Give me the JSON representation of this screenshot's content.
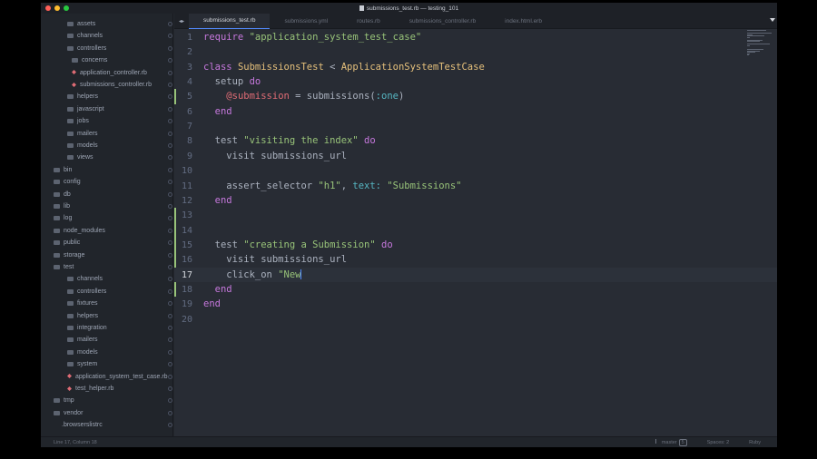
{
  "window": {
    "title": "submissions_test.rb — testing_101"
  },
  "sidebar": {
    "items": [
      {
        "label": "assets",
        "type": "folder",
        "indent": 1
      },
      {
        "label": "channels",
        "type": "folder",
        "indent": 1
      },
      {
        "label": "controllers",
        "type": "folder",
        "indent": 1
      },
      {
        "label": "concerns",
        "type": "folder",
        "indent": 2
      },
      {
        "label": "application_controller.rb",
        "type": "ruby",
        "indent": 2
      },
      {
        "label": "submissions_controller.rb",
        "type": "ruby",
        "indent": 2
      },
      {
        "label": "helpers",
        "type": "folder",
        "indent": 1
      },
      {
        "label": "javascript",
        "type": "folder",
        "indent": 1
      },
      {
        "label": "jobs",
        "type": "folder",
        "indent": 1
      },
      {
        "label": "mailers",
        "type": "folder",
        "indent": 1
      },
      {
        "label": "models",
        "type": "folder",
        "indent": 1
      },
      {
        "label": "views",
        "type": "folder",
        "indent": 1
      },
      {
        "label": "bin",
        "type": "folder",
        "indent": 0
      },
      {
        "label": "config",
        "type": "folder",
        "indent": 0
      },
      {
        "label": "db",
        "type": "folder",
        "indent": 0
      },
      {
        "label": "lib",
        "type": "folder",
        "indent": 0
      },
      {
        "label": "log",
        "type": "folder",
        "indent": 0
      },
      {
        "label": "node_modules",
        "type": "folder",
        "indent": 0
      },
      {
        "label": "public",
        "type": "folder",
        "indent": 0
      },
      {
        "label": "storage",
        "type": "folder",
        "indent": 0
      },
      {
        "label": "test",
        "type": "folder",
        "indent": 0
      },
      {
        "label": "channels",
        "type": "folder",
        "indent": 1
      },
      {
        "label": "controllers",
        "type": "folder",
        "indent": 1
      },
      {
        "label": "fixtures",
        "type": "folder",
        "indent": 1
      },
      {
        "label": "helpers",
        "type": "folder",
        "indent": 1
      },
      {
        "label": "integration",
        "type": "folder",
        "indent": 1
      },
      {
        "label": "mailers",
        "type": "folder",
        "indent": 1
      },
      {
        "label": "models",
        "type": "folder",
        "indent": 1
      },
      {
        "label": "system",
        "type": "folder",
        "indent": 1
      },
      {
        "label": "application_system_test_case.rb",
        "type": "ruby",
        "indent": 1
      },
      {
        "label": "test_helper.rb",
        "type": "ruby",
        "indent": 1
      },
      {
        "label": "tmp",
        "type": "folder",
        "indent": 0
      },
      {
        "label": "vendor",
        "type": "folder",
        "indent": 0
      },
      {
        "label": ".browserslistrc",
        "type": "file",
        "indent": 0
      }
    ]
  },
  "tabs": [
    {
      "label": "submissions_test.rb",
      "active": true
    },
    {
      "label": "submissions.yml",
      "active": false
    },
    {
      "label": "routes.rb",
      "active": false
    },
    {
      "label": "submissions_controller.rb",
      "active": false
    },
    {
      "label": "index.html.erb",
      "active": false
    }
  ],
  "editor": {
    "current_line": 17,
    "lines": [
      {
        "n": "1",
        "tokens": [
          [
            "kw",
            "require"
          ],
          [
            "plain",
            " "
          ],
          [
            "str",
            "\"application_system_test_case\""
          ]
        ]
      },
      {
        "n": "2",
        "tokens": []
      },
      {
        "n": "3",
        "tokens": [
          [
            "kw",
            "class"
          ],
          [
            "plain",
            " "
          ],
          [
            "cls",
            "SubmissionsTest"
          ],
          [
            "plain",
            " < "
          ],
          [
            "cls",
            "ApplicationSystemTestCase"
          ]
        ]
      },
      {
        "n": "4",
        "tokens": [
          [
            "plain",
            "  setup "
          ],
          [
            "kw",
            "do"
          ]
        ]
      },
      {
        "n": "5",
        "tokens": [
          [
            "plain",
            "    "
          ],
          [
            "ivar",
            "@submission"
          ],
          [
            "plain",
            " = submissions("
          ],
          [
            "sym",
            ":one"
          ],
          [
            "plain",
            ")"
          ]
        ]
      },
      {
        "n": "6",
        "tokens": [
          [
            "plain",
            "  "
          ],
          [
            "kw",
            "end"
          ]
        ]
      },
      {
        "n": "7",
        "tokens": []
      },
      {
        "n": "8",
        "tokens": [
          [
            "plain",
            "  test "
          ],
          [
            "str",
            "\"visiting the index\""
          ],
          [
            "plain",
            " "
          ],
          [
            "kw",
            "do"
          ]
        ]
      },
      {
        "n": "9",
        "tokens": [
          [
            "plain",
            "    visit submissions_url"
          ]
        ]
      },
      {
        "n": "10",
        "tokens": []
      },
      {
        "n": "11",
        "tokens": [
          [
            "plain",
            "    assert_selector "
          ],
          [
            "str",
            "\"h1\""
          ],
          [
            "plain",
            ", "
          ],
          [
            "sym",
            "text:"
          ],
          [
            "plain",
            " "
          ],
          [
            "str",
            "\"Submissions\""
          ]
        ]
      },
      {
        "n": "12",
        "tokens": [
          [
            "plain",
            "  "
          ],
          [
            "kw",
            "end"
          ]
        ]
      },
      {
        "n": "13",
        "tokens": []
      },
      {
        "n": "14",
        "tokens": []
      },
      {
        "n": "15",
        "tokens": [
          [
            "plain",
            "  test "
          ],
          [
            "str",
            "\"creating a Submission\""
          ],
          [
            "plain",
            " "
          ],
          [
            "kw",
            "do"
          ]
        ]
      },
      {
        "n": "16",
        "tokens": [
          [
            "plain",
            "    visit submissions_url"
          ]
        ]
      },
      {
        "n": "17",
        "tokens": [
          [
            "plain",
            "    click_on "
          ],
          [
            "str",
            "\"New"
          ]
        ],
        "caret": true
      },
      {
        "n": "18",
        "tokens": [
          [
            "plain",
            "  "
          ],
          [
            "kw",
            "end"
          ]
        ]
      },
      {
        "n": "19",
        "tokens": [
          [
            "kw",
            "end"
          ]
        ]
      },
      {
        "n": "20",
        "tokens": []
      }
    ]
  },
  "status": {
    "position": "Line 17, Column 18",
    "branch": "master",
    "branch_badge": "5",
    "spaces": "Spaces: 2",
    "syntax": "Ruby"
  },
  "colors": {
    "background": "#282c34",
    "sidebar": "#21252b",
    "keyword": "#c678dd",
    "string": "#98c379",
    "class": "#e5c07b",
    "ivar": "#e06c75"
  }
}
